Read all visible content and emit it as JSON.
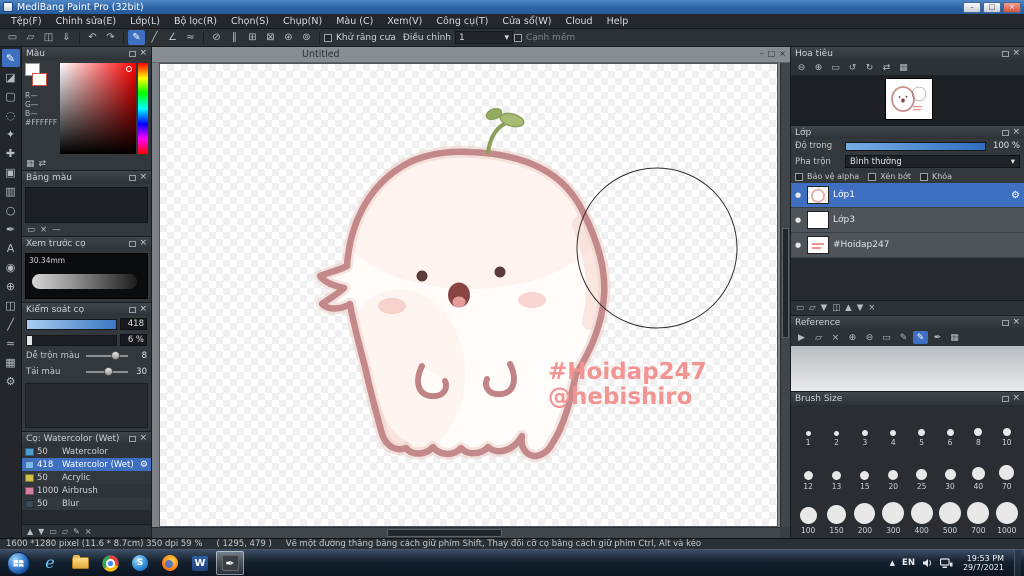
{
  "window": {
    "title": "MediBang Paint Pro (32bit)"
  },
  "icons": {
    "minimize": "–",
    "maximize": "□",
    "close": "×",
    "new": "▭",
    "open": "▱",
    "save": "◫",
    "export": "⇓",
    "undo": "↶",
    "redo": "↷",
    "pen": "✎",
    "line": "╱",
    "broken_line": "∠",
    "curve": "≈",
    "snap_off": "⊘",
    "snap_parallel": "∥",
    "snap_cross": "⊞",
    "snap_vanish": "⊠",
    "snap_radial": "⊛",
    "snap_ellipse": "⊚",
    "gear": "⚙",
    "grid": "▦",
    "swap": "⇄",
    "trash": "×",
    "page": "▭",
    "folder": "▱",
    "zoom_in": "⊕",
    "zoom_out": "⊖",
    "fit": "▭",
    "rotate_left": "↺",
    "rotate_right": "↻",
    "up": "▲",
    "down": "▼",
    "dash": "—",
    "eye": "●",
    "caret": "▾",
    "select": "▢",
    "lasso": "◌",
    "wand": "✦",
    "move": "✚",
    "fill": "▣",
    "gradient": "▥",
    "brush": "✎",
    "eraser": "◪",
    "blur": "○",
    "dropper": "✒",
    "text": "A",
    "hand": "◉",
    "divide": "◫",
    "arrow": "▶"
  },
  "menu": [
    "Tệp(F)",
    "Chỉnh sửa(E)",
    "Lớp(L)",
    "Bộ lọc(R)",
    "Chọn(S)",
    "Chụp(N)",
    "Màu (C)",
    "Xem(V)",
    "Công cụ(T)",
    "Cửa sổ(W)",
    "Cloud",
    "Help"
  ],
  "toolbar": {
    "antialias": "Khử răng cưa",
    "correction": "Điều chỉnh",
    "correction_value": "1",
    "soft_edge": "Cạnh mềm"
  },
  "color_panel": {
    "title": "Màu",
    "r": "R—",
    "g": "G—",
    "b": "B—",
    "hex": "#FFFFFF"
  },
  "palette_panel": {
    "title": "Bảng màu"
  },
  "preview_panel": {
    "title": "Xem trước cọ",
    "size": "30.34mm"
  },
  "control_panel": {
    "title": "Kiểm soát cọ",
    "size": "418",
    "opacity": "6 %",
    "mix": "Dễ trộn màu",
    "mix_v": "8",
    "load": "Tải màu",
    "load_v": "30"
  },
  "brush_panel": {
    "title": "Cọ: Watercolor (Wet)",
    "brushes": [
      {
        "size": "50",
        "name": "Watercolor",
        "swatch": "#4d9fd6"
      },
      {
        "size": "418",
        "name": "Watercolor (Wet)",
        "swatch": "#7db8e8",
        "selected": true
      },
      {
        "size": "50",
        "name": "Acrylic",
        "swatch": "#cfc24a"
      },
      {
        "size": "1000",
        "name": "Airbrush",
        "swatch": "#d77f9e"
      },
      {
        "size": "50",
        "name": "Blur",
        "swatch": "#3a4a5a"
      }
    ]
  },
  "canvas": {
    "tab": "Untitled",
    "wm1": "#Hoidap247",
    "wm2": "@hebishiro"
  },
  "navigator": {
    "title": "Hoa tiêu"
  },
  "layer_panel": {
    "title": "Lớp",
    "opacity_label": "Độ trong",
    "opacity_value": "100 %",
    "blend_label": "Pha trộn",
    "blend_value": "Bình thường",
    "cb1": "Bảo vệ alpha",
    "cb2": "Xén bớt",
    "cb3": "Khóa",
    "layers": [
      {
        "name": "Lớp1",
        "selected": true
      },
      {
        "name": "Lớp3"
      },
      {
        "name": "#Hoidap247"
      }
    ]
  },
  "reference_panel": {
    "title": "Reference"
  },
  "brush_size_panel": {
    "title": "Brush Size",
    "sizes": [
      1,
      2,
      3,
      4,
      5,
      6,
      8,
      10,
      12,
      13,
      15,
      20,
      25,
      30,
      40,
      70,
      100,
      150,
      200,
      300,
      400,
      500,
      700,
      1000
    ]
  },
  "status": {
    "info": "1600 *1280 pixel   (11.6 * 8.7cm)   350 dpi   59 %",
    "coords": "( 1295, 479 )",
    "hint": "Vẽ một đường thẳng bằng cách giữ phím Shift, Thay đổi cỡ cọ bằng cách giữ phím Ctrl, Alt và kéo"
  },
  "taskbar": {
    "lang": "EN",
    "time": "19:53 PM",
    "date": "29/7/2021"
  },
  "colors": {
    "accent": "#3e6fc0",
    "selection_blue": "#3f72c8",
    "outline_pink": "#c08486",
    "watermark_pink": "#f19492"
  }
}
